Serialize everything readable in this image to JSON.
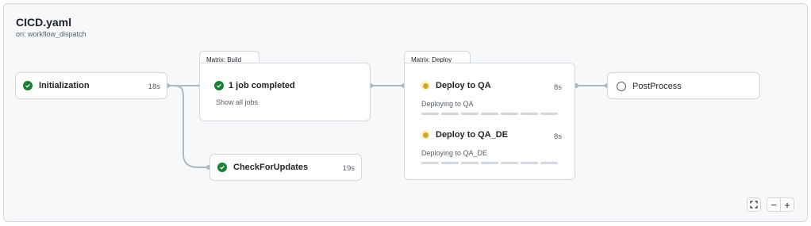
{
  "workflow": {
    "file": "CICD.yaml",
    "trigger": "on: workflow_dispatch"
  },
  "jobs": {
    "initialization": {
      "name": "Initialization",
      "duration": "18s",
      "status": "success"
    },
    "check_updates": {
      "name": "CheckForUpdates",
      "duration": "19s",
      "status": "success"
    },
    "postprocess": {
      "name": "PostProcess",
      "status": "pending"
    }
  },
  "matrix_build": {
    "label": "Matrix: Build",
    "summary": "1 job completed",
    "link": "Show all jobs",
    "status": "success"
  },
  "matrix_deploy": {
    "label": "Matrix: Deploy",
    "jobs": [
      {
        "name": "Deploy to QA",
        "duration": "8s",
        "detail": "Deploying to QA",
        "status": "in_progress"
      },
      {
        "name": "Deploy to QA_DE",
        "duration": "8s",
        "detail": "Deploying to QA_DE",
        "status": "in_progress"
      }
    ]
  },
  "zoom": {
    "fullscreen_icon": "fullscreen-icon",
    "zoom_out_label": "−",
    "zoom_in_label": "+"
  },
  "colors": {
    "success": "#1a7f37",
    "in_progress": "#d4a72c",
    "connector": "#afb8c1"
  }
}
